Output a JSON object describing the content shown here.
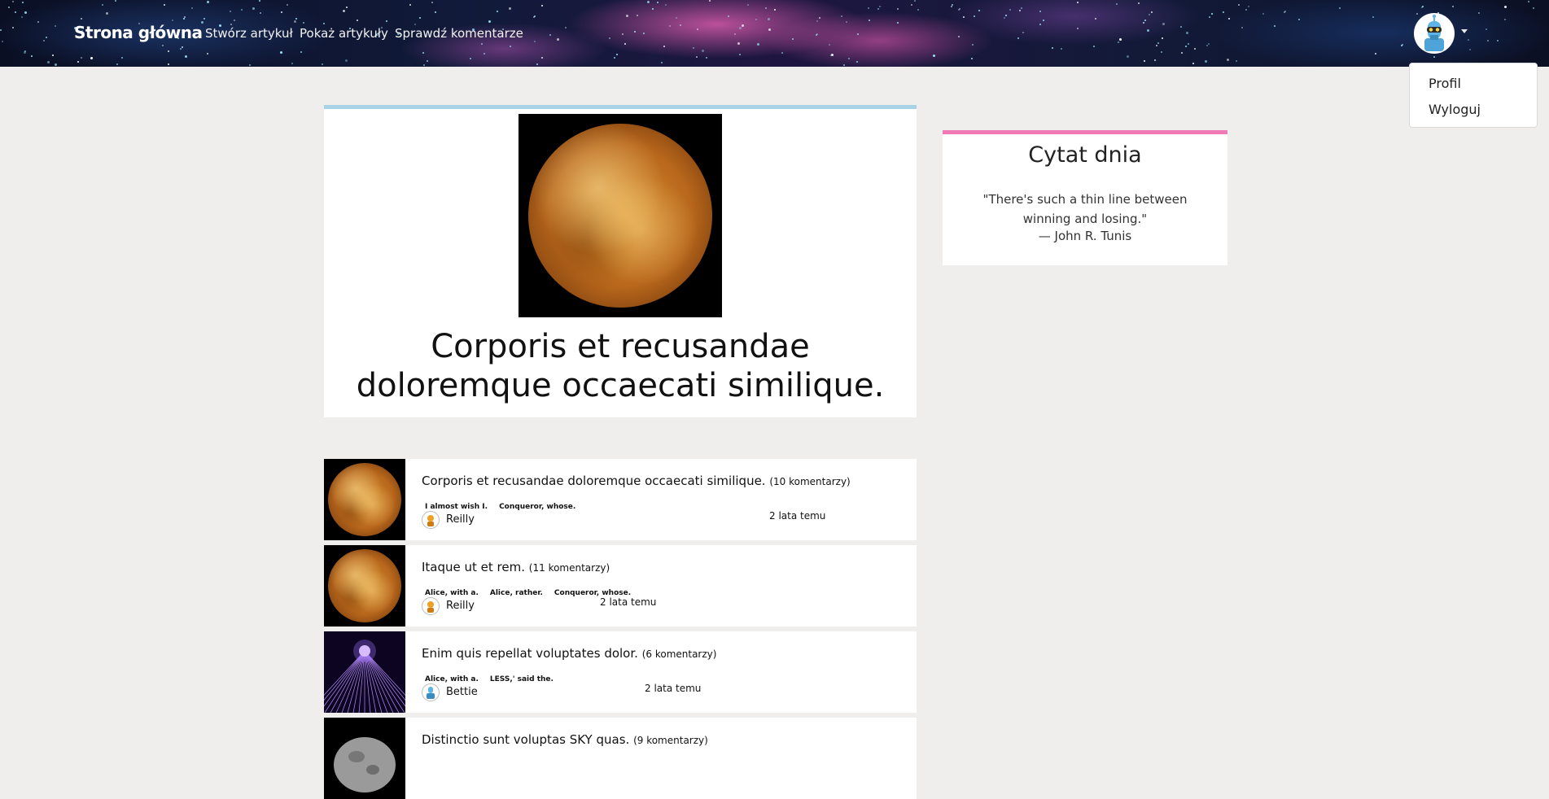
{
  "navbar": {
    "brand": "Strona główna",
    "links": [
      "Stwórz artykuł",
      "Pokaż artykuły",
      "Sprawdź komentarze"
    ],
    "user_avatar_icon": "robot-avatar-icon"
  },
  "user_menu": {
    "items": [
      "Profil",
      "Wyloguj"
    ]
  },
  "featured": {
    "title": "Corporis et recusandae doloremque occaecati similique.",
    "image_icon": "planet-image"
  },
  "quote": {
    "heading": "Cytat dnia",
    "text": "\"There's such a thin line between winning and losing.\"",
    "author": "— John R. Tunis"
  },
  "articles": [
    {
      "title": "Corporis et recusandae doloremque occaecati similique.",
      "comments": "(10 komentarzy)",
      "tags": [
        "I almost wish I.",
        "Conqueror, whose."
      ],
      "author": "Reilly",
      "date": "2 lata temu",
      "thumb": "planet"
    },
    {
      "title": "Itaque ut et rem.",
      "comments": "(11 komentarzy)",
      "tags": [
        "Alice, with a.",
        "Alice, rather.",
        "Conqueror, whose."
      ],
      "author": "Reilly",
      "date": "2 lata temu",
      "thumb": "planet"
    },
    {
      "title": "Enim quis repellat voluptates dolor.",
      "comments": "(6 komentarzy)",
      "tags": [
        "Alice, with a.",
        "LESS,' said the."
      ],
      "author": "Bettie",
      "date": "2 lata temu",
      "thumb": "warp"
    },
    {
      "title": "Distinctio sunt voluptas SKY quas.",
      "comments": "(9 komentarzy)",
      "tags": [],
      "author": "",
      "date": "",
      "thumb": "asteroid"
    }
  ],
  "colors": {
    "background": "#efeeec",
    "featured_accent": "#a8d3e6",
    "quote_accent": "#f07ab8"
  }
}
